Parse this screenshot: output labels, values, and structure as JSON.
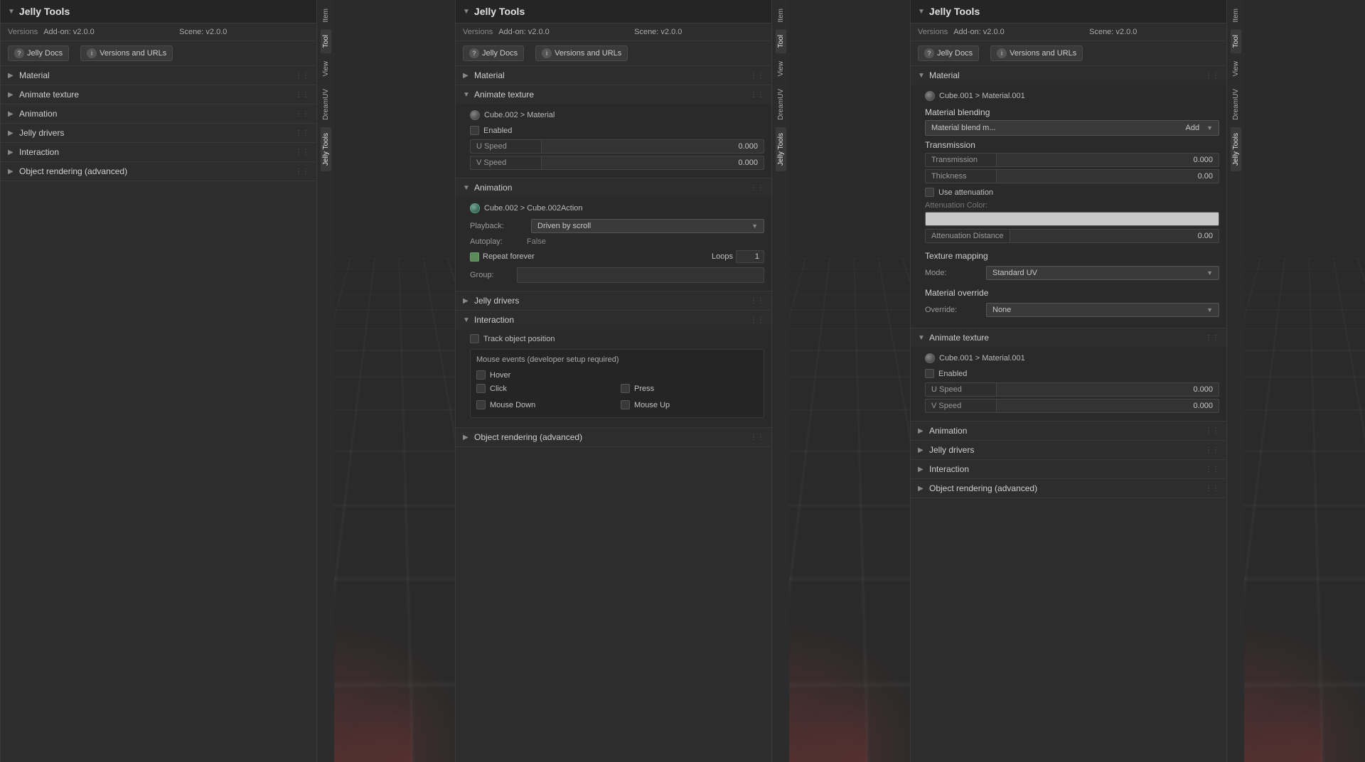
{
  "panels": [
    {
      "id": "left",
      "title": "Jelly Tools",
      "versions": {
        "label": "Versions",
        "addon": "Add-on: v2.0.0",
        "scene": "Scene: v2.0.0",
        "docs_btn": "Jelly Docs",
        "versions_btn": "Versions and URLs"
      },
      "sections": [
        {
          "id": "material",
          "label": "Material",
          "open": false
        },
        {
          "id": "animate-texture",
          "label": "Animate texture",
          "open": false
        },
        {
          "id": "animation",
          "label": "Animation",
          "open": false
        },
        {
          "id": "jelly-drivers",
          "label": "Jelly drivers",
          "open": false
        },
        {
          "id": "interaction",
          "label": "Interaction",
          "open": false
        },
        {
          "id": "object-rendering",
          "label": "Object rendering (advanced)",
          "open": false
        }
      ],
      "side_tabs": [
        "Item",
        "Tool",
        "View",
        "DreamUV",
        "Jelly Tools"
      ]
    },
    {
      "id": "mid",
      "title": "Jelly Tools",
      "versions": {
        "label": "Versions",
        "addon": "Add-on: v2.0.0",
        "scene": "Scene: v2.0.0",
        "docs_btn": "Jelly Docs",
        "versions_btn": "Versions and URLs"
      },
      "material": {
        "open": false
      },
      "animate_texture": {
        "open": true,
        "sub_path": "Cube.002 > Material",
        "enabled_checked": false,
        "u_speed": "0.000",
        "v_speed": "0.000"
      },
      "animation": {
        "open": true,
        "sub_path": "Cube.002 > Cube.002Action",
        "playback_label": "Playback:",
        "playback_value": "Driven by scroll",
        "autoplay_label": "Autoplay:",
        "autoplay_value": "False",
        "repeat_forever_checked": true,
        "repeat_forever_label": "Repeat forever",
        "loops_label": "Loops",
        "loops_value": "1",
        "group_label": "Group:"
      },
      "jelly_drivers": {
        "open": false,
        "label": "Jelly drivers"
      },
      "interaction": {
        "open": true,
        "track_obj_checked": false,
        "track_obj_label": "Track object position",
        "mouse_events_title": "Mouse events (developer setup required)",
        "hover_checked": false,
        "hover_label": "Hover",
        "click_checked": false,
        "click_label": "Click",
        "press_checked": false,
        "press_label": "Press",
        "mousedown_checked": false,
        "mousedown_label": "Mouse Down",
        "mouseup_checked": false,
        "mouseup_label": "Mouse Up"
      },
      "object_rendering": {
        "open": false,
        "label": "Object rendering (advanced)"
      },
      "side_tabs": [
        "Item",
        "Tool",
        "View",
        "DreamUV",
        "Jelly Tools"
      ]
    },
    {
      "id": "right",
      "title": "Jelly Tools",
      "versions": {
        "label": "Versions",
        "addon": "Add-on: v2.0.0",
        "scene": "Scene: v2.0.0",
        "docs_btn": "Jelly Docs",
        "versions_btn": "Versions and URLs"
      },
      "material": {
        "open": true,
        "sub_path": "Cube.001 > Material.001",
        "material_blending_title": "Material blending",
        "material_blend_mode_label": "Material blend m...",
        "material_blend_mode_value": "Add",
        "transmission_title": "Transmission",
        "transmission_label": "Transmission",
        "transmission_value": "0.000",
        "thickness_label": "Thickness",
        "thickness_value": "0.00",
        "use_attenuation_checked": false,
        "use_attenuation_label": "Use attenuation",
        "attenuation_color_label": "Attenuation Color:",
        "attenuation_distance_label": "Attenuation Distance",
        "attenuation_distance_value": "0.00",
        "texture_mapping_title": "Texture mapping",
        "mode_label": "Mode:",
        "mode_value": "Standard UV",
        "material_override_title": "Material override",
        "override_label": "Override:",
        "override_value": "None"
      },
      "animate_texture": {
        "open": true,
        "sub_path": "Cube.001 > Material.001",
        "enabled_checked": false,
        "u_speed": "0.000",
        "v_speed": "0.000"
      },
      "animation": {
        "open": false,
        "label": "Animation"
      },
      "jelly_drivers": {
        "open": false,
        "label": "Jelly drivers"
      },
      "interaction": {
        "open": false,
        "label": "Interaction"
      },
      "object_rendering": {
        "open": false,
        "label": "Object rendering (advanced)"
      },
      "side_tabs": [
        "Item",
        "Tool",
        "View",
        "DreamUV",
        "Jelly Tools"
      ]
    }
  ]
}
